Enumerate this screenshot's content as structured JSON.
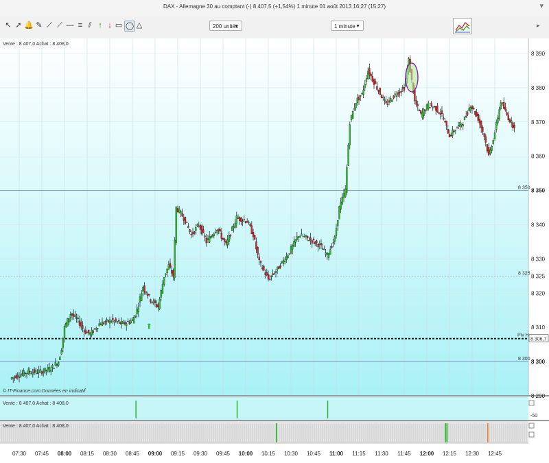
{
  "window": {
    "title": "DAX - Allemagne 30 au comptant (-)   8 407,5 (+1,54%)     1 minute  01 août 2013 16:27 (15:27)"
  },
  "toolbar": {
    "units_select": "200 unités",
    "interval_select": "1 minute",
    "icons": [
      "cursor-icon",
      "pointer-icon",
      "alarm-icon",
      "magic-wand-icon",
      "trend-line-icon",
      "horizontal-line-icon",
      "fibonacci-icon",
      "buy-arrow-icon",
      "sell-arrow-icon",
      "rectangle-icon",
      "ellipse-icon",
      "triangle-icon"
    ]
  },
  "chart": {
    "info_label": "Vente : 8 407,0  Achat : 8 408,0",
    "credit": "© IT-Finance.com  Données en indicatif",
    "pivot_label": "Piv H",
    "current_price_label": "8 306,7",
    "right_labels": [
      "8 390",
      "8 380",
      "8 370",
      "8 360",
      "8 350",
      "8 340",
      "8 330",
      "8 325",
      "8 320",
      "8 310",
      "8 300",
      "8 290"
    ],
    "bold_right_labels": [
      "8 350",
      "8 300"
    ],
    "inline_labels": [
      "8 350",
      "8 325",
      "8 300"
    ]
  },
  "panel2": {
    "info_label": "Vente : 8 407,0  Achat : 8 408,0",
    "axis_label": "-50"
  },
  "panel3": {
    "info_label": "Vente : 8 407,0  Achat : 8 408,0"
  },
  "time_axis": {
    "labels": [
      "07:30",
      "07:45",
      "08:00",
      "08:15",
      "08:30",
      "08:45",
      "09:00",
      "09:15",
      "09:30",
      "09:45",
      "10:00",
      "10:15",
      "10:30",
      "10:45",
      "11:00",
      "11:15",
      "11:30",
      "11:45",
      "12:00",
      "12:15",
      "12:30",
      "12:45"
    ],
    "bold_labels": [
      "08:00",
      "09:00",
      "10:00",
      "11:00",
      "12:00"
    ]
  },
  "chart_data": {
    "type": "candlestick",
    "instrument": "DAX - Allemagne 30 au comptant (-)",
    "interval": "1 minute",
    "y_axis_range": [
      8290,
      8392
    ],
    "y_ticks": [
      8290,
      8300,
      8310,
      8320,
      8330,
      8340,
      8350,
      8360,
      8370,
      8380,
      8390
    ],
    "reference_lines": [
      {
        "value": 8350,
        "style": "solid"
      },
      {
        "value": 8325,
        "style": "dashed"
      },
      {
        "value": 8306.7,
        "style": "dotted-bold",
        "label": "Piv H"
      },
      {
        "value": 8300,
        "style": "solid"
      }
    ],
    "x_time_labels": [
      "07:30",
      "07:45",
      "08:00",
      "08:15",
      "08:30",
      "08:45",
      "09:00",
      "09:15",
      "09:30",
      "09:45",
      "10:00",
      "10:15",
      "10:30",
      "10:45",
      "11:00",
      "11:15",
      "11:30",
      "11:45",
      "12:00",
      "12:15",
      "12:30",
      "12:45"
    ],
    "price_path": [
      [
        "07:25",
        8295
      ],
      [
        "07:30",
        8296
      ],
      [
        "07:37",
        8297
      ],
      [
        "07:45",
        8297
      ],
      [
        "07:52",
        8298
      ],
      [
        "07:57",
        8300
      ],
      [
        "07:59",
        8304
      ],
      [
        "08:01",
        8310
      ],
      [
        "08:05",
        8314
      ],
      [
        "08:10",
        8312
      ],
      [
        "08:14",
        8309
      ],
      [
        "08:18",
        8308
      ],
      [
        "08:24",
        8311
      ],
      [
        "08:32",
        8312
      ],
      [
        "08:40",
        8311
      ],
      [
        "08:46",
        8312
      ],
      [
        "08:49",
        8315
      ],
      [
        "08:53",
        8322
      ],
      [
        "08:58",
        8318
      ],
      [
        "09:03",
        8316
      ],
      [
        "09:07",
        8325
      ],
      [
        "09:10",
        8328
      ],
      [
        "09:13",
        8325
      ],
      [
        "09:15",
        8345
      ],
      [
        "09:20",
        8342
      ],
      [
        "09:25",
        8337
      ],
      [
        "09:30",
        8340
      ],
      [
        "09:35",
        8335
      ],
      [
        "09:42",
        8339
      ],
      [
        "09:48",
        8334
      ],
      [
        "09:55",
        8342
      ],
      [
        "10:02",
        8341
      ],
      [
        "10:06",
        8337
      ],
      [
        "10:10",
        8329
      ],
      [
        "10:16",
        8324
      ],
      [
        "10:22",
        8327
      ],
      [
        "10:30",
        8332
      ],
      [
        "10:36",
        8337
      ],
      [
        "10:42",
        8336
      ],
      [
        "10:50",
        8334
      ],
      [
        "10:55",
        8331
      ],
      [
        "11:00",
        8336
      ],
      [
        "11:03",
        8345
      ],
      [
        "11:07",
        8350
      ],
      [
        "11:10",
        8370
      ],
      [
        "11:14",
        8376
      ],
      [
        "11:18",
        8378
      ],
      [
        "11:22",
        8385
      ],
      [
        "11:28",
        8380
      ],
      [
        "11:34",
        8375
      ],
      [
        "11:40",
        8378
      ],
      [
        "11:46",
        8380
      ],
      [
        "11:49",
        8388
      ],
      [
        "11:53",
        8376
      ],
      [
        "11:57",
        8372
      ],
      [
        "12:02",
        8375
      ],
      [
        "12:07",
        8374
      ],
      [
        "12:11",
        8372
      ],
      [
        "12:16",
        8366
      ],
      [
        "12:20",
        8368
      ],
      [
        "12:25",
        8370
      ],
      [
        "12:30",
        8375
      ],
      [
        "12:35",
        8371
      ],
      [
        "12:39",
        8366
      ],
      [
        "12:42",
        8360
      ],
      [
        "12:46",
        8367
      ],
      [
        "12:50",
        8376
      ],
      [
        "12:54",
        8372
      ],
      [
        "12:58",
        8369
      ]
    ],
    "highlight_ellipse_around": "11:50"
  }
}
